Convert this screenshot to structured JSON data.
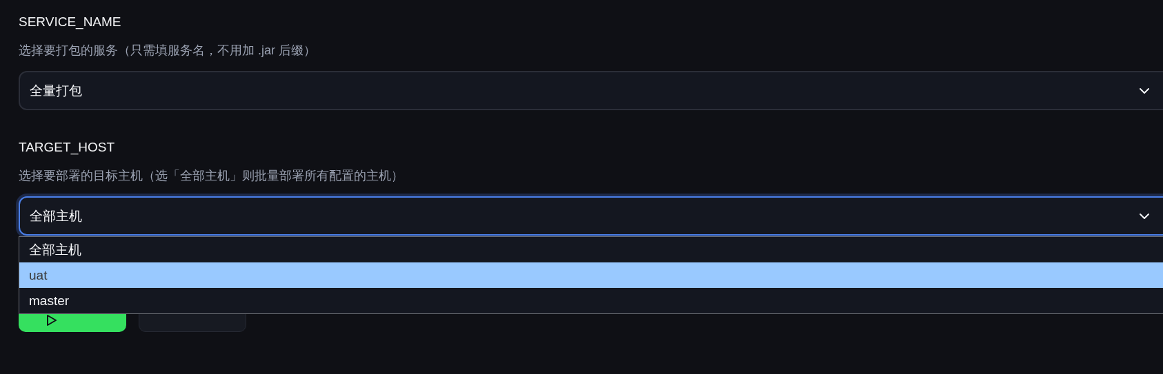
{
  "fields": [
    {
      "label": "SERVICE_NAME",
      "hint": "选择要打包的服务（只需填服务名，不用加 .jar 后缀）",
      "value": "全量打包",
      "focused": false
    },
    {
      "label": "TARGET_HOST",
      "hint": "选择要部署的目标主机（选「全部主机」则批量部署所有配置的主机）",
      "value": "全部主机",
      "focused": true,
      "options": [
        {
          "label": "全部主机",
          "highlighted": false
        },
        {
          "label": "uat",
          "highlighted": true
        },
        {
          "label": "master",
          "highlighted": false
        }
      ]
    }
  ],
  "buttons": [
    {
      "kind": "primary"
    },
    {
      "kind": "secondary"
    }
  ]
}
